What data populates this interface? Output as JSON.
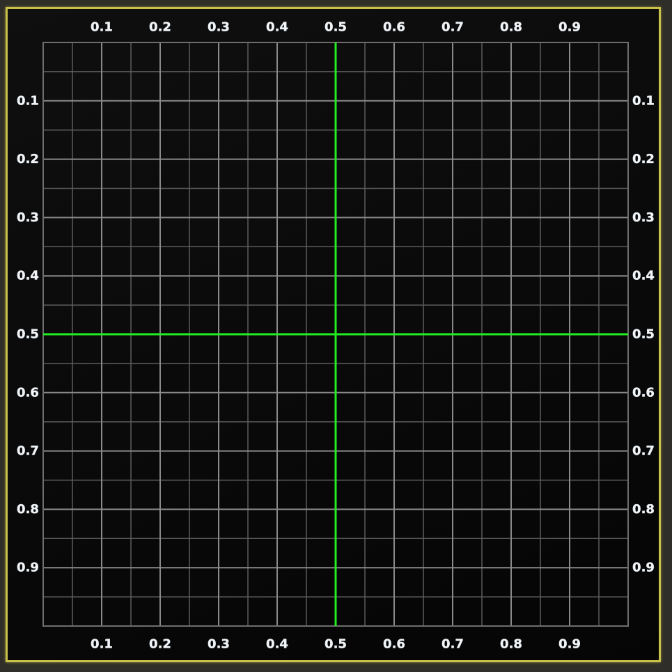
{
  "grid": {
    "major_ticks": [
      "0.1",
      "0.2",
      "0.3",
      "0.4",
      "0.5",
      "0.6",
      "0.7",
      "0.8",
      "0.9"
    ],
    "minor_divisions_per_major": 2,
    "crosshair": {
      "x": 0.5,
      "y": 0.5,
      "color": "#22ee22"
    },
    "line_color": "#8a8a8a",
    "frame_color": "#c9c24a"
  }
}
